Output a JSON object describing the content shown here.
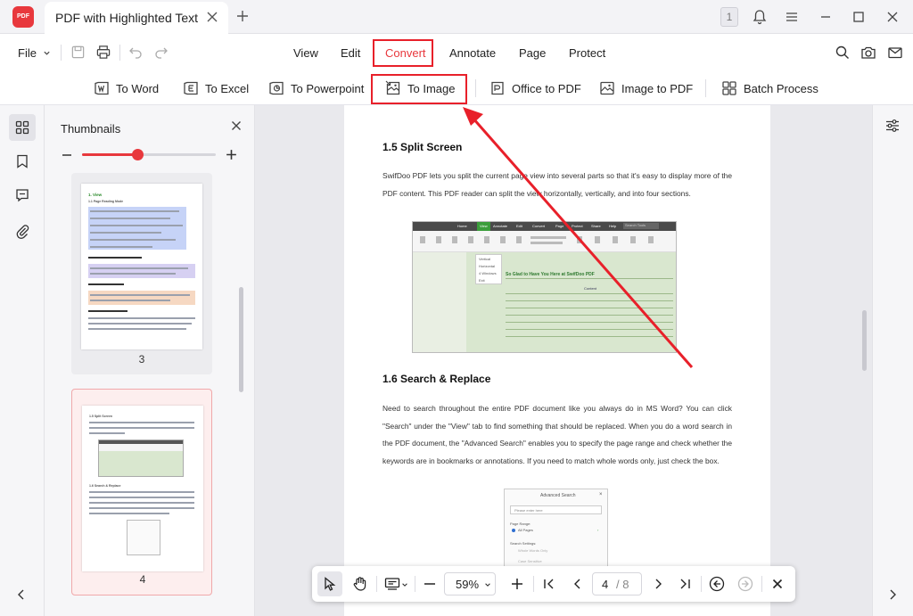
{
  "app": {
    "logo_text": "PDF",
    "tab_title": "PDF with Highlighted Text",
    "window_badge": "1",
    "accent": "#e8383d"
  },
  "menubar": {
    "file_label": "File",
    "items": [
      {
        "label": "View"
      },
      {
        "label": "Edit"
      },
      {
        "label": "Convert",
        "active": true
      },
      {
        "label": "Annotate"
      },
      {
        "label": "Page"
      },
      {
        "label": "Protect"
      }
    ]
  },
  "toolbar": {
    "tools": [
      {
        "label": "To Word",
        "icon": "word-icon"
      },
      {
        "label": "To Excel",
        "icon": "excel-icon"
      },
      {
        "label": "To Powerpoint",
        "icon": "powerpoint-icon"
      },
      {
        "label": "To Image",
        "icon": "image-convert-icon"
      },
      {
        "label": "Office to PDF",
        "icon": "office-icon"
      },
      {
        "label": "Image to PDF",
        "icon": "image-pdf-icon"
      },
      {
        "label": "Batch Process",
        "icon": "batch-icon"
      }
    ]
  },
  "thumbnails": {
    "title": "Thumbnails",
    "zoom_fraction": 0.5,
    "pages": [
      {
        "number": "3",
        "heading": "1. View",
        "sub": "1.1 Page Reading Mode"
      },
      {
        "number": "4",
        "heading": "1.5 Split Screen",
        "sub": "1.6 Search & Replace",
        "selected": true
      }
    ]
  },
  "document": {
    "section1_title": "1.5 Split Screen",
    "section1_text": "SwifDoo PDF lets you split the current page view into several parts so that it's easy to display more of the PDF content. This PDF reader can split the view horizontally, vertically, and into four sections.",
    "section2_title": "1.6 Search & Replace",
    "section2_text": "Need to search throughout the entire PDF document like you always do in MS Word? You can click \"Search\" under the \"View\" tab to find something that should be replaced. When you do a word search in the PDF document, the \"Advanced Search\" enables you to specify the page range and check whether the keywords are in bookmarks or annotations. If you need to match whole words only, just check the box.",
    "shot1": {
      "menu": [
        "Home",
        "View",
        "Annotate",
        "Edit",
        "Convert",
        "Page",
        "Protect",
        "Share",
        "Help"
      ],
      "search_placeholder": "Search Tools",
      "dropdown": [
        "Vertical",
        "Horizontal",
        "4 Windows",
        "Exit"
      ],
      "heading": "So Glad to Have You Here at SwifDoo PDF",
      "content_label": "Content"
    },
    "shot2": {
      "title": "Advanced Search",
      "placeholder": "Please enter here",
      "page_range_label": "Page Range:",
      "all_pages": "All Pages",
      "settings_label": "Search Settings:",
      "whole_words": "Whole Words Only",
      "case_sensitive": "Case Sensitive"
    }
  },
  "bottombar": {
    "zoom": "59%",
    "current_page": "4",
    "total_pages": "/ 8"
  }
}
